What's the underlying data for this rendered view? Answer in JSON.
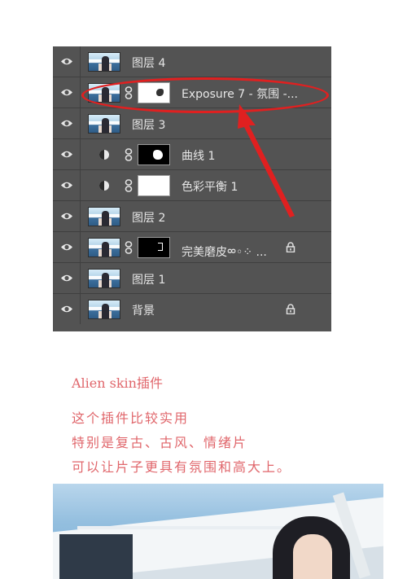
{
  "layers_panel": {
    "layers": [
      {
        "name": "图层 4",
        "kind": "image",
        "visible": true
      },
      {
        "name": "Exposure 7 - 氛围 -...",
        "kind": "image-with-mask",
        "visible": true,
        "highlighted": true
      },
      {
        "name": "图层 3",
        "kind": "image",
        "visible": true
      },
      {
        "name": "曲线 1",
        "kind": "adjustment",
        "visible": true
      },
      {
        "name": "色彩平衡 1",
        "kind": "adjustment",
        "visible": true
      },
      {
        "name": "图层 2",
        "kind": "image",
        "visible": true
      },
      {
        "name": "完美磨皮ᢁ◦⁘ ...",
        "kind": "image-with-mask",
        "visible": true,
        "locked": true
      },
      {
        "name": "图层 1",
        "kind": "image",
        "visible": true
      },
      {
        "name": "背景",
        "kind": "image",
        "visible": true,
        "locked": true
      }
    ]
  },
  "annotation": {
    "color": "#e02020"
  },
  "caption": {
    "title": "Alien skin插件",
    "lines": [
      "这个插件比较实用",
      "特别是复古、古风、情绪片",
      "可以让片子更具有氛围和高大上。"
    ],
    "color": "#e0666b"
  },
  "colors": {
    "panel_bg": "#535353",
    "panel_text": "#e6e6e6"
  }
}
